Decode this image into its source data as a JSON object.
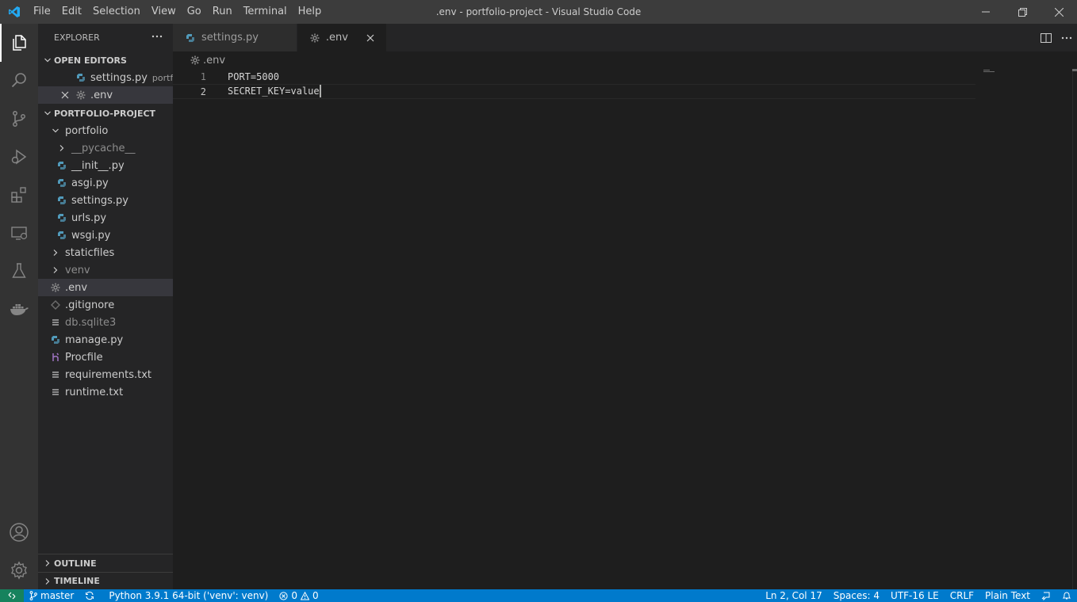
{
  "window": {
    "title": ".env - portfolio-project - Visual Studio Code"
  },
  "menu": [
    "File",
    "Edit",
    "Selection",
    "View",
    "Go",
    "Run",
    "Terminal",
    "Help"
  ],
  "sidebar": {
    "title": "EXPLORER",
    "open_editors": {
      "label": "OPEN EDITORS",
      "items": [
        {
          "name": "settings.py",
          "desc": "portf...",
          "icon": "python-file-icon"
        },
        {
          "name": ".env",
          "desc": "",
          "icon": "gear-file-icon"
        }
      ]
    },
    "project": {
      "label": "PORTFOLIO-PROJECT",
      "items": [
        {
          "name": "portfolio",
          "type": "folder-open",
          "indent": 1
        },
        {
          "name": "__pycache__",
          "type": "folder",
          "indent": 2
        },
        {
          "name": "__init__.py",
          "type": "python",
          "indent": 2
        },
        {
          "name": "asgi.py",
          "type": "python",
          "indent": 2
        },
        {
          "name": "settings.py",
          "type": "python",
          "indent": 2
        },
        {
          "name": "urls.py",
          "type": "python",
          "indent": 2
        },
        {
          "name": "wsgi.py",
          "type": "python",
          "indent": 2
        },
        {
          "name": "staticfiles",
          "type": "folder",
          "indent": 1
        },
        {
          "name": "venv",
          "type": "folder",
          "indent": 1
        },
        {
          "name": ".env",
          "type": "gear",
          "indent": 1
        },
        {
          "name": ".gitignore",
          "type": "git",
          "indent": 1
        },
        {
          "name": "db.sqlite3",
          "type": "text",
          "indent": 1
        },
        {
          "name": "manage.py",
          "type": "python",
          "indent": 1
        },
        {
          "name": "Procfile",
          "type": "heroku",
          "indent": 1
        },
        {
          "name": "requirements.txt",
          "type": "text",
          "indent": 1
        },
        {
          "name": "runtime.txt",
          "type": "text",
          "indent": 1
        }
      ]
    },
    "outline_label": "OUTLINE",
    "timeline_label": "TIMELINE"
  },
  "tabs": [
    {
      "label": "settings.py",
      "active": false
    },
    {
      "label": ".env",
      "active": true
    }
  ],
  "breadcrumb": ".env",
  "editor": {
    "lines": [
      {
        "num": "1",
        "text": "PORT=5000"
      },
      {
        "num": "2",
        "text": "SECRET_KEY=value"
      }
    ]
  },
  "status": {
    "branch": "master",
    "python": "Python 3.9.1 64-bit ('venv': venv)",
    "errors": "0",
    "warnings": "0",
    "position": "Ln 2, Col 17",
    "spaces": "Spaces: 4",
    "encoding": "UTF-16 LE",
    "eol": "CRLF",
    "language": "Plain Text"
  },
  "colors": {
    "accent": "#007acc",
    "remote": "#16825d",
    "python_icon": "#519aba",
    "heroku_icon": "#a074c4"
  }
}
